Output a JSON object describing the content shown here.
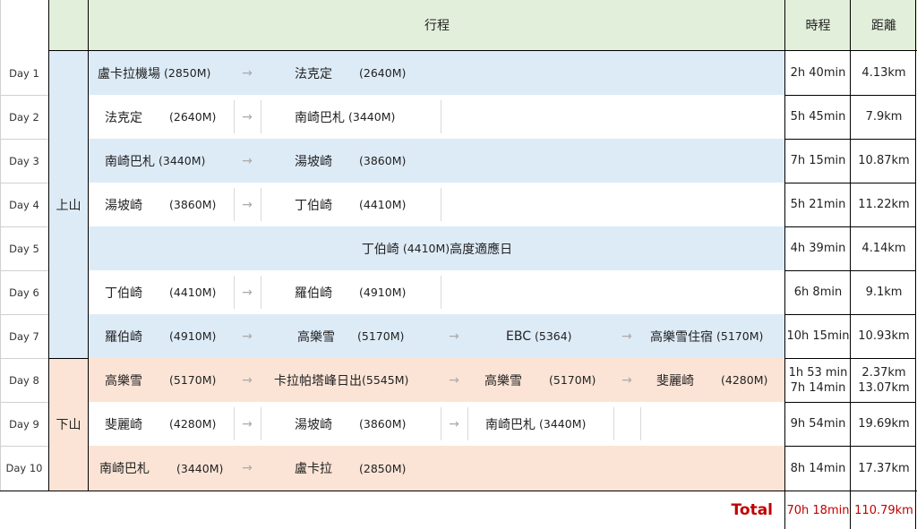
{
  "header": {
    "itinerary": "行程",
    "duration": "時程",
    "distance": "距離"
  },
  "groups": {
    "up": "上山",
    "down": "下山"
  },
  "days": [
    {
      "label": "Day 1",
      "time": "2h 40min",
      "distance": "4.13km",
      "stops": [
        {
          "name": "盧卡拉機場",
          "elev": "(2850M)"
        },
        {
          "name": "法克定",
          "elev": "(2640M)"
        }
      ]
    },
    {
      "label": "Day 2",
      "time": "5h 45min",
      "distance": "7.9km",
      "stops": [
        {
          "name": "法克定",
          "elev": "(2640M)"
        },
        {
          "name": "南崎巴札",
          "elev": "(3440M)"
        }
      ]
    },
    {
      "label": "Day 3",
      "time": "7h 15min",
      "distance": "10.87km",
      "stops": [
        {
          "name": "南崎巴札",
          "elev": "(3440M)"
        },
        {
          "name": "湯坡崎",
          "elev": "(3860M)"
        }
      ]
    },
    {
      "label": "Day 4",
      "time": "5h 21min",
      "distance": "11.22km",
      "stops": [
        {
          "name": "湯坡崎",
          "elev": "(3860M)"
        },
        {
          "name": "丁伯崎",
          "elev": "(4410M)"
        }
      ]
    },
    {
      "label": "Day 5",
      "time": "4h 39min",
      "distance": "4.14km",
      "note": {
        "name": "丁伯崎",
        "elev": "(4410M)",
        "suffix": "高度適應日"
      }
    },
    {
      "label": "Day 6",
      "time": "6h 8min",
      "distance": "9.1km",
      "stops": [
        {
          "name": "丁伯崎",
          "elev": "(4410M)"
        },
        {
          "name": "羅伯崎",
          "elev": "(4910M)"
        }
      ]
    },
    {
      "label": "Day 7",
      "time": "10h 15min",
      "distance": "10.93km",
      "stops": [
        {
          "name": "羅伯崎",
          "elev": "(4910M)"
        },
        {
          "name": "高樂雪",
          "elev": "(5170M)"
        },
        {
          "name": "EBC",
          "elev": "(5364)"
        },
        {
          "name": "高樂雪住宿",
          "elev": "(5170M)"
        }
      ]
    },
    {
      "label": "Day 8",
      "time": "1h 53 min",
      "time2": "7h 14min",
      "distance": "2.37km",
      "distance2": "13.07km",
      "stops": [
        {
          "name": "高樂雪",
          "elev": "(5170M)"
        },
        {
          "name": "卡拉帕塔峰日出",
          "elev": "(5545M)"
        },
        {
          "name": "高樂雪",
          "elev": "(5170M)"
        },
        {
          "name": "斐麗崎",
          "elev": "(4280M)"
        }
      ]
    },
    {
      "label": "Day 9",
      "time": "9h 54min",
      "distance": "19.69km",
      "stops": [
        {
          "name": "斐麗崎",
          "elev": "(4280M)"
        },
        {
          "name": "湯坡崎",
          "elev": "(3860M)"
        },
        {
          "name": "南崎巴札",
          "elev": "(3440M)"
        }
      ]
    },
    {
      "label": "Day 10",
      "time": "8h 14min",
      "distance": "17.37km",
      "stops": [
        {
          "name": "南崎巴札",
          "elev": "(3440M)"
        },
        {
          "name": "盧卡拉",
          "elev": "(2850M)"
        }
      ]
    }
  ],
  "arrow": "→",
  "total": {
    "label": "Total",
    "time": "70h 18min",
    "distance": "110.79km"
  },
  "colors": {
    "header_bg": "#e2efda",
    "up_bg": "#ddebf7",
    "down_bg": "#fbe4d6",
    "total_text": "#c00000"
  }
}
